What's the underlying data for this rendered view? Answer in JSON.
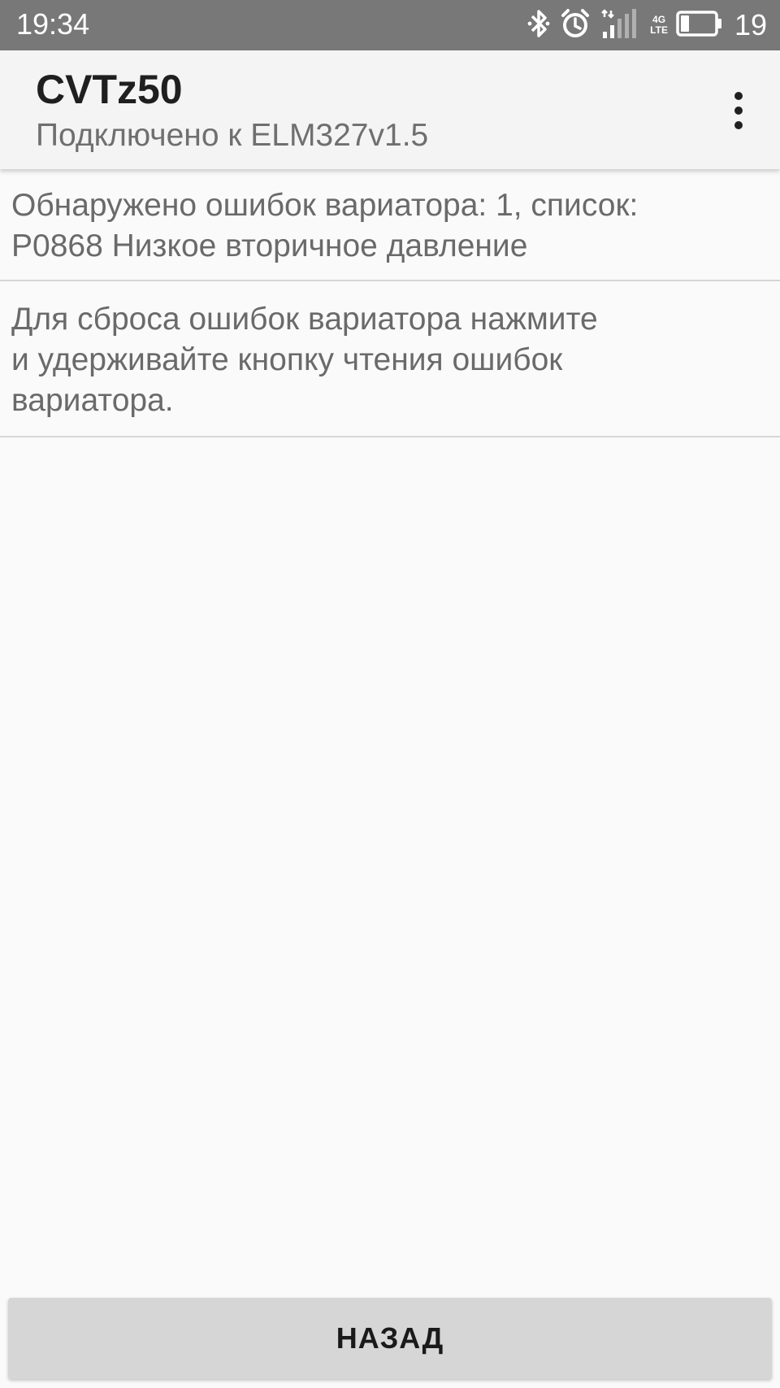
{
  "status_bar": {
    "time": "19:34",
    "icons": [
      "bluetooth-icon",
      "alarm-icon",
      "signal-icon",
      "4g-lte-icon",
      "battery-icon"
    ],
    "network_label_top": "4G",
    "network_label_bottom": "LTE",
    "battery_level": "19"
  },
  "app_bar": {
    "title": "CVTz50",
    "subtitle": "Подключено к ELM327v1.5",
    "overflow_icon": "more-vert-icon"
  },
  "messages": [
    {
      "lines": [
        "Обнаружено ошибок вариатора: 1, список:",
        "P0868 Низкое вторичное давление"
      ]
    },
    {
      "lines": [
        "Для сброса ошибок вариатора нажмите",
        "и удерживайте кнопку чтения ошибок",
        "вариатора."
      ]
    }
  ],
  "footer": {
    "back_label": "НАЗАД"
  },
  "colors": {
    "status_bar": "#787878",
    "app_bar": "#f4f4f4",
    "background": "#fafafa",
    "button": "#d6d6d6",
    "text_secondary": "#6a6a6a"
  }
}
